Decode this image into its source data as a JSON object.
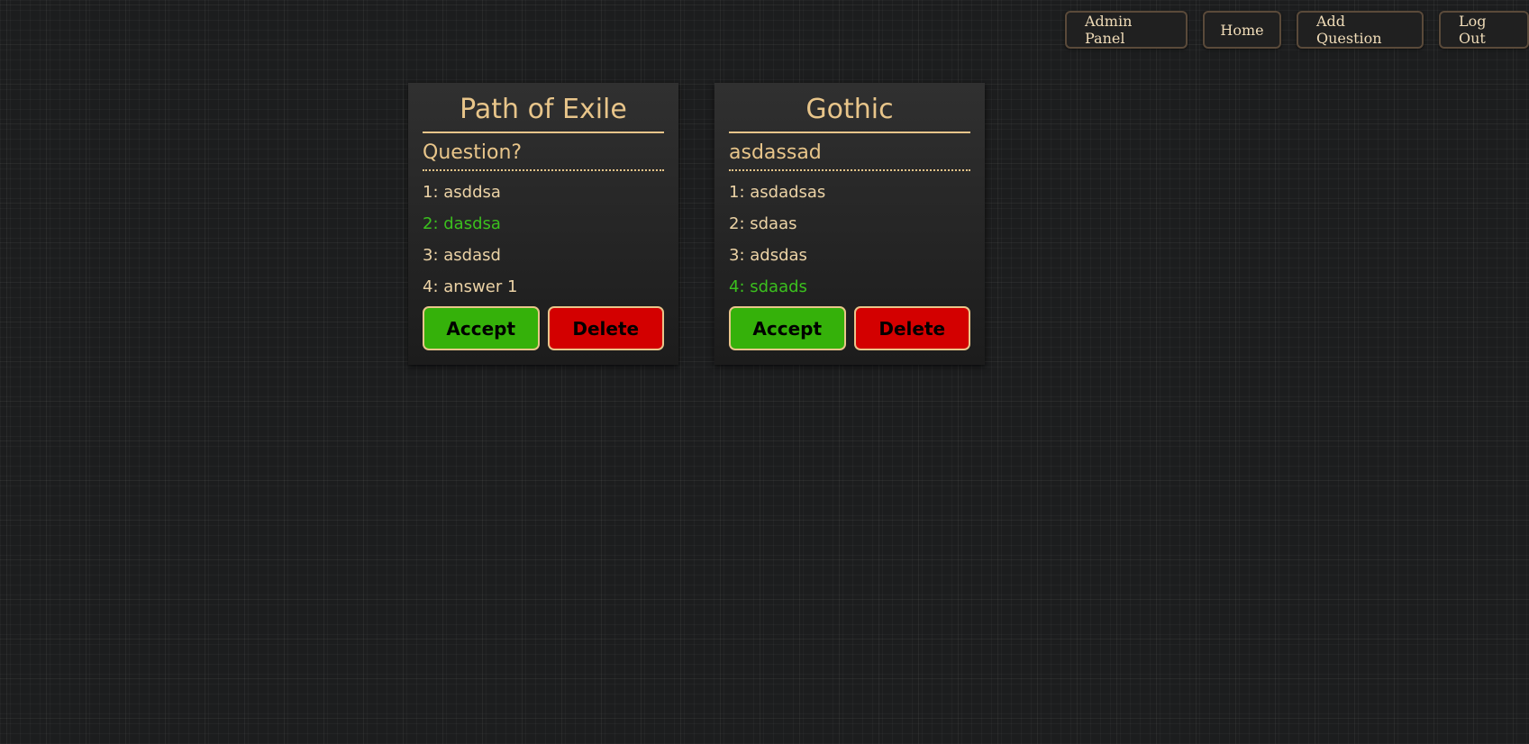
{
  "nav": {
    "admin_panel": "Admin Panel",
    "home": "Home",
    "add_question": "Add Question",
    "log_out": "Log Out"
  },
  "cards": [
    {
      "title": "Path of Exile",
      "question": "Question?",
      "answers": [
        {
          "label": "1: asddsa",
          "correct": false
        },
        {
          "label": "2: dasdsa",
          "correct": true
        },
        {
          "label": "3: asdasd",
          "correct": false
        },
        {
          "label": "4: answer 1",
          "correct": false
        }
      ],
      "accept_label": "Accept",
      "delete_label": "Delete"
    },
    {
      "title": "Gothic",
      "question": "asdassad",
      "answers": [
        {
          "label": "1: asdadsas",
          "correct": false
        },
        {
          "label": "2: sdaas",
          "correct": false
        },
        {
          "label": "3: adsdas",
          "correct": false
        },
        {
          "label": "4: sdaads",
          "correct": true
        }
      ],
      "accept_label": "Accept",
      "delete_label": "Delete"
    }
  ],
  "colors": {
    "accent_gold": "#e8c58a",
    "correct_green": "#3bc01e",
    "accept_green": "#35b10a",
    "delete_red": "#d30000"
  }
}
